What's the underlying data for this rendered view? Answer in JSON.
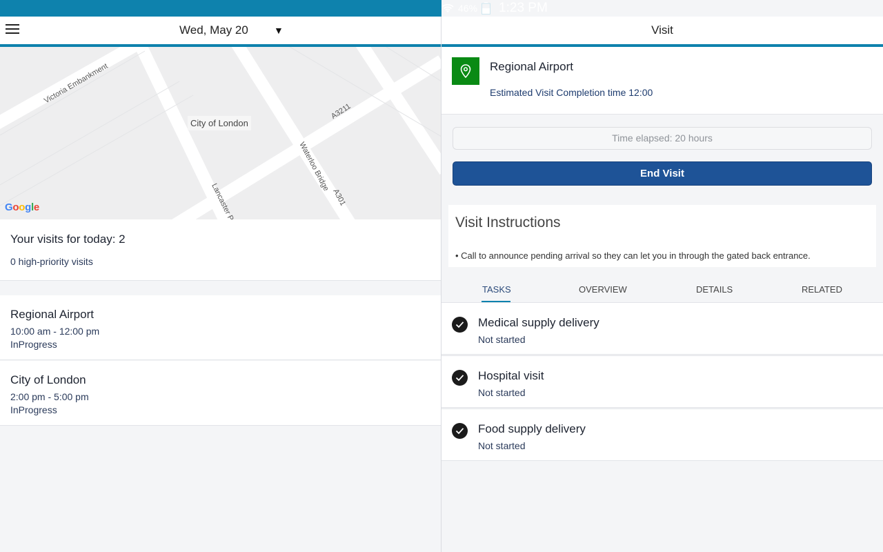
{
  "status_bar": {
    "battery_pct": "46%",
    "time": "1:23 PM"
  },
  "left_header": {
    "date": "Wed, May 20"
  },
  "map": {
    "city_label": "City of London",
    "streets": [
      "Victoria Embankment",
      "A3211",
      "Waterloo Bridge",
      "A301",
      "Lancaster Pl"
    ],
    "brand": [
      "G",
      "o",
      "o",
      "g",
      "l",
      "e"
    ],
    "brand_colors": [
      "#4285F4",
      "#EA4335",
      "#FBBC05",
      "#4285F4",
      "#34A853",
      "#EA4335"
    ]
  },
  "summary": {
    "visits_today": "Your visits for today: 2",
    "high_priority": "0 high-priority visits"
  },
  "visits": [
    {
      "name": "Regional Airport",
      "time": "10:00 am - 12:00 pm",
      "status": "InProgress"
    },
    {
      "name": "City of London",
      "time": "2:00 pm - 5:00 pm",
      "status": "InProgress"
    }
  ],
  "right_header": {
    "title": "Visit"
  },
  "location": {
    "name": "Regional Airport",
    "estimate": "Estimated Visit Completion time 12:00"
  },
  "elapsed": "Time elapsed: 20 hours",
  "end_visit_label": "End Visit",
  "instructions": {
    "title": "Visit Instructions",
    "text": "• Call to announce pending arrival so they can let you in through the gated back entrance."
  },
  "tabs": [
    "TASKS",
    "OVERVIEW",
    "DETAILS",
    "RELATED"
  ],
  "tasks": [
    {
      "name": "Medical supply delivery",
      "status": "Not started"
    },
    {
      "name": "Hospital visit",
      "status": "Not started"
    },
    {
      "name": "Food supply delivery",
      "status": "Not started"
    }
  ],
  "colors": {
    "accent": "#0e82ad",
    "primary_button": "#1e5397",
    "pin_green": "#0a8a14"
  }
}
